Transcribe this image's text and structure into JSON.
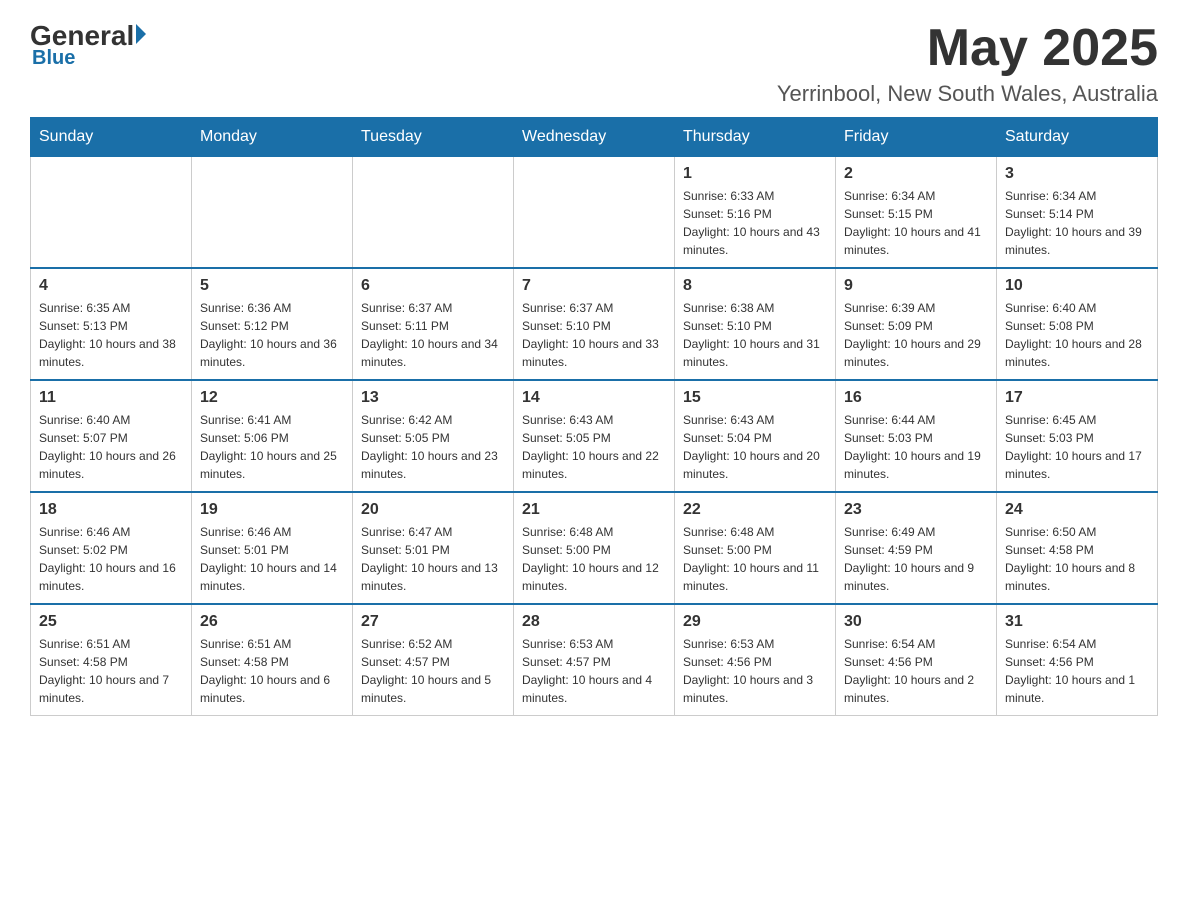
{
  "header": {
    "logo": {
      "general": "General",
      "blue": "Blue"
    },
    "title": "May 2025",
    "location": "Yerrinbool, New South Wales, Australia"
  },
  "days_of_week": [
    "Sunday",
    "Monday",
    "Tuesday",
    "Wednesday",
    "Thursday",
    "Friday",
    "Saturday"
  ],
  "weeks": [
    [
      {
        "day": "",
        "info": ""
      },
      {
        "day": "",
        "info": ""
      },
      {
        "day": "",
        "info": ""
      },
      {
        "day": "",
        "info": ""
      },
      {
        "day": "1",
        "info": "Sunrise: 6:33 AM\nSunset: 5:16 PM\nDaylight: 10 hours and 43 minutes."
      },
      {
        "day": "2",
        "info": "Sunrise: 6:34 AM\nSunset: 5:15 PM\nDaylight: 10 hours and 41 minutes."
      },
      {
        "day": "3",
        "info": "Sunrise: 6:34 AM\nSunset: 5:14 PM\nDaylight: 10 hours and 39 minutes."
      }
    ],
    [
      {
        "day": "4",
        "info": "Sunrise: 6:35 AM\nSunset: 5:13 PM\nDaylight: 10 hours and 38 minutes."
      },
      {
        "day": "5",
        "info": "Sunrise: 6:36 AM\nSunset: 5:12 PM\nDaylight: 10 hours and 36 minutes."
      },
      {
        "day": "6",
        "info": "Sunrise: 6:37 AM\nSunset: 5:11 PM\nDaylight: 10 hours and 34 minutes."
      },
      {
        "day": "7",
        "info": "Sunrise: 6:37 AM\nSunset: 5:10 PM\nDaylight: 10 hours and 33 minutes."
      },
      {
        "day": "8",
        "info": "Sunrise: 6:38 AM\nSunset: 5:10 PM\nDaylight: 10 hours and 31 minutes."
      },
      {
        "day": "9",
        "info": "Sunrise: 6:39 AM\nSunset: 5:09 PM\nDaylight: 10 hours and 29 minutes."
      },
      {
        "day": "10",
        "info": "Sunrise: 6:40 AM\nSunset: 5:08 PM\nDaylight: 10 hours and 28 minutes."
      }
    ],
    [
      {
        "day": "11",
        "info": "Sunrise: 6:40 AM\nSunset: 5:07 PM\nDaylight: 10 hours and 26 minutes."
      },
      {
        "day": "12",
        "info": "Sunrise: 6:41 AM\nSunset: 5:06 PM\nDaylight: 10 hours and 25 minutes."
      },
      {
        "day": "13",
        "info": "Sunrise: 6:42 AM\nSunset: 5:05 PM\nDaylight: 10 hours and 23 minutes."
      },
      {
        "day": "14",
        "info": "Sunrise: 6:43 AM\nSunset: 5:05 PM\nDaylight: 10 hours and 22 minutes."
      },
      {
        "day": "15",
        "info": "Sunrise: 6:43 AM\nSunset: 5:04 PM\nDaylight: 10 hours and 20 minutes."
      },
      {
        "day": "16",
        "info": "Sunrise: 6:44 AM\nSunset: 5:03 PM\nDaylight: 10 hours and 19 minutes."
      },
      {
        "day": "17",
        "info": "Sunrise: 6:45 AM\nSunset: 5:03 PM\nDaylight: 10 hours and 17 minutes."
      }
    ],
    [
      {
        "day": "18",
        "info": "Sunrise: 6:46 AM\nSunset: 5:02 PM\nDaylight: 10 hours and 16 minutes."
      },
      {
        "day": "19",
        "info": "Sunrise: 6:46 AM\nSunset: 5:01 PM\nDaylight: 10 hours and 14 minutes."
      },
      {
        "day": "20",
        "info": "Sunrise: 6:47 AM\nSunset: 5:01 PM\nDaylight: 10 hours and 13 minutes."
      },
      {
        "day": "21",
        "info": "Sunrise: 6:48 AM\nSunset: 5:00 PM\nDaylight: 10 hours and 12 minutes."
      },
      {
        "day": "22",
        "info": "Sunrise: 6:48 AM\nSunset: 5:00 PM\nDaylight: 10 hours and 11 minutes."
      },
      {
        "day": "23",
        "info": "Sunrise: 6:49 AM\nSunset: 4:59 PM\nDaylight: 10 hours and 9 minutes."
      },
      {
        "day": "24",
        "info": "Sunrise: 6:50 AM\nSunset: 4:58 PM\nDaylight: 10 hours and 8 minutes."
      }
    ],
    [
      {
        "day": "25",
        "info": "Sunrise: 6:51 AM\nSunset: 4:58 PM\nDaylight: 10 hours and 7 minutes."
      },
      {
        "day": "26",
        "info": "Sunrise: 6:51 AM\nSunset: 4:58 PM\nDaylight: 10 hours and 6 minutes."
      },
      {
        "day": "27",
        "info": "Sunrise: 6:52 AM\nSunset: 4:57 PM\nDaylight: 10 hours and 5 minutes."
      },
      {
        "day": "28",
        "info": "Sunrise: 6:53 AM\nSunset: 4:57 PM\nDaylight: 10 hours and 4 minutes."
      },
      {
        "day": "29",
        "info": "Sunrise: 6:53 AM\nSunset: 4:56 PM\nDaylight: 10 hours and 3 minutes."
      },
      {
        "day": "30",
        "info": "Sunrise: 6:54 AM\nSunset: 4:56 PM\nDaylight: 10 hours and 2 minutes."
      },
      {
        "day": "31",
        "info": "Sunrise: 6:54 AM\nSunset: 4:56 PM\nDaylight: 10 hours and 1 minute."
      }
    ]
  ]
}
